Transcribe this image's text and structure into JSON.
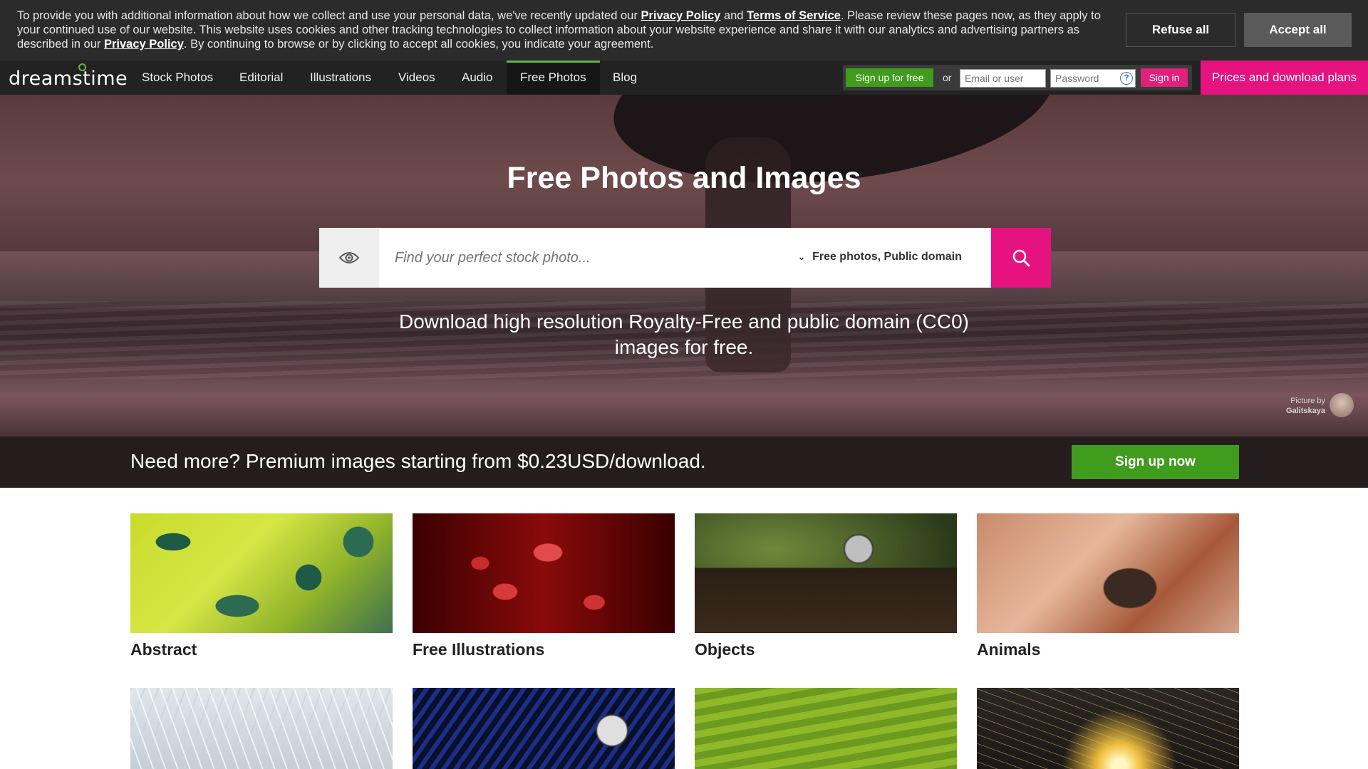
{
  "cookie_banner": {
    "text_part1": "To provide you with additional information about how we collect and use your personal data, we've recently updated our ",
    "privacy_link": "Privacy Policy",
    "and": " and ",
    "terms_link": "Terms of Service",
    "text_part2": ". Please review these pages now, as they apply to your continued use of our website. This website uses cookies and other tracking technologies to collect information about your website experience and share it with our analytics and advertising partners as described in our ",
    "privacy_link2": "Privacy Policy",
    "text_part3": ". By continuing to browse or by clicking to accept all cookies, you indicate your agreement.",
    "refuse_label": "Refuse all",
    "accept_label": "Accept all"
  },
  "nav": {
    "logo": "dreamstime",
    "items": [
      {
        "label": "Stock Photos"
      },
      {
        "label": "Editorial"
      },
      {
        "label": "Illustrations"
      },
      {
        "label": "Videos"
      },
      {
        "label": "Audio"
      },
      {
        "label": "Free Photos"
      },
      {
        "label": "Blog"
      }
    ],
    "signup_free_label": "Sign up for free",
    "or_text": "or",
    "email_placeholder": "Email or user",
    "password_placeholder": "Password",
    "signin_label": "Sign in",
    "plans_label": "Prices and download plans"
  },
  "hero": {
    "title": "Free Photos and Images",
    "search_placeholder": "Find your perfect stock photo...",
    "search_filter": "Free photos, Public domain",
    "subtitle": "Download high resolution Royalty-Free and public domain (CC0) images for free.",
    "credit_label": "Picture by",
    "credit_name": "Galitskaya"
  },
  "premium": {
    "text": "Need more? Premium images starting from $0.23USD/download.",
    "signup_label": "Sign up now"
  },
  "categories": [
    {
      "label": "Abstract"
    },
    {
      "label": "Free Illustrations"
    },
    {
      "label": "Objects"
    },
    {
      "label": "Animals"
    }
  ],
  "colors": {
    "accent_pink": "#e5127f",
    "accent_green": "#3f9c1d",
    "nav_bg": "#222222"
  }
}
